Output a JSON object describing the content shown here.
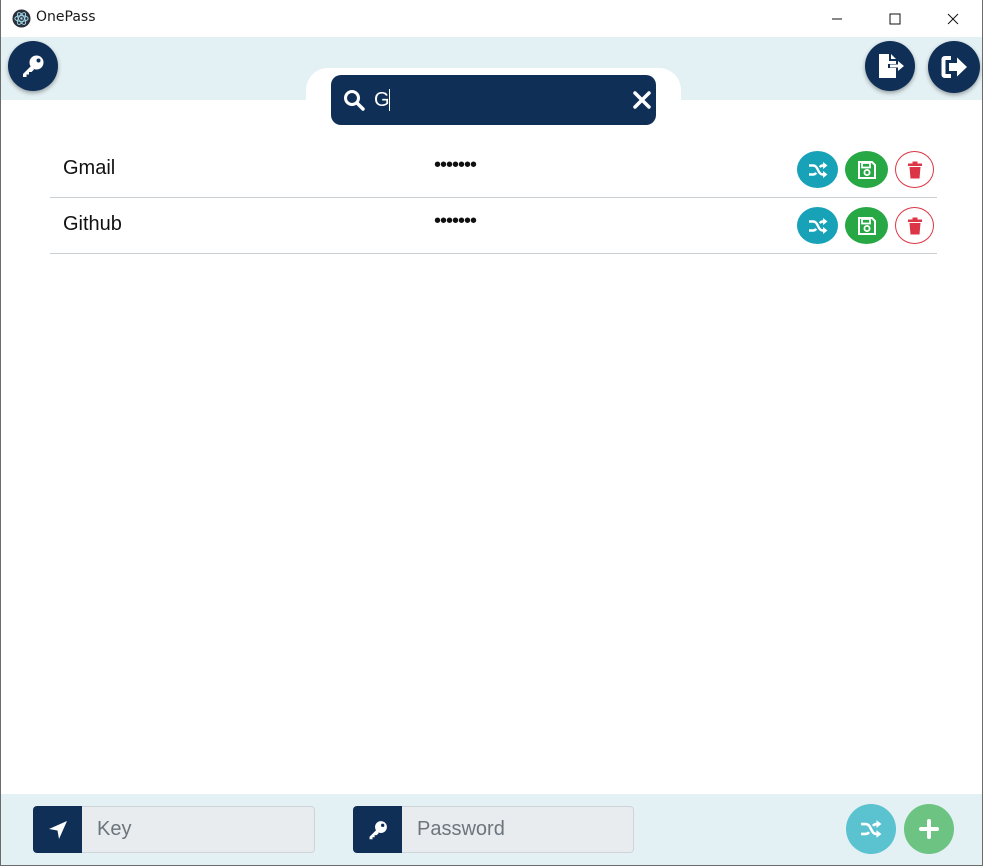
{
  "window": {
    "title": "OnePass"
  },
  "search": {
    "value": "G"
  },
  "entries": [
    {
      "name": "Gmail",
      "password_mask": "•••••••"
    },
    {
      "name": "Github",
      "password_mask": "•••••••"
    }
  ],
  "footer": {
    "key_placeholder": "Key",
    "password_placeholder": "Password"
  },
  "colors": {
    "navy": "#0f2f57",
    "header_bg": "#e4f1f4",
    "shuffle": "#17a2b8",
    "save": "#28a745",
    "delete": "#dc3545"
  },
  "icons": {
    "header_left": "key-icon",
    "header_right": [
      "file-export-icon",
      "sign-out-icon"
    ],
    "row_actions": [
      "shuffle-icon",
      "save-icon",
      "trash-icon"
    ],
    "footer_fields": [
      "location-arrow-icon",
      "key-icon"
    ],
    "footer_actions": [
      "shuffle-icon",
      "plus-icon"
    ]
  }
}
